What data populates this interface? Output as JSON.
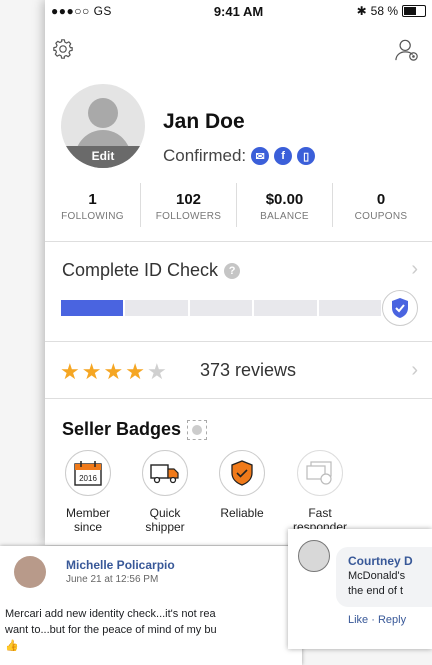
{
  "status_bar": {
    "carrier": "●●●○○ GS",
    "time": "9:41 AM",
    "battery": "58 %",
    "battery_level": 0.58
  },
  "profile": {
    "name": "Jan Doe",
    "confirmed_label": "Confirmed:",
    "edit_label": "Edit",
    "confirmed_icons": [
      "email-icon",
      "facebook-icon",
      "phone-icon"
    ]
  },
  "stats": [
    {
      "value": "1",
      "label": "FOLLOWING"
    },
    {
      "value": "102",
      "label": "FOLLOWERS"
    },
    {
      "value": "$0.00",
      "label": "BALANCE"
    },
    {
      "value": "0",
      "label": "COUPONS"
    }
  ],
  "id_check": {
    "label": "Complete ID Check",
    "progress_segments": 5,
    "progress_filled": 1
  },
  "reviews": {
    "rating": 4,
    "max": 5,
    "label": "373 reviews"
  },
  "seller_badges": {
    "title": "Seller Badges",
    "items": [
      {
        "label": "Member since",
        "icon_text": "2016"
      },
      {
        "label": "Quick shipper",
        "icon": "truck-icon"
      },
      {
        "label": "Reliable",
        "icon": "shield-check-icon"
      },
      {
        "label": "Fast responder",
        "icon": "chat-clock-icon"
      }
    ]
  },
  "post": {
    "author": "Michelle Policarpio",
    "date": "June 21 at 12:56 PM",
    "line1": "Mercari add new identity check...it's not rea",
    "line2": "want to...but for the peace of mind of my bu",
    "emoji": "👍"
  },
  "comment": {
    "author": "Courtney D",
    "line1": "McDonald's",
    "line2": "the end of t",
    "actions": "Like · Reply"
  },
  "colors": {
    "accent": "#4a64e0",
    "star": "#f5a623",
    "badge_orange": "#f07a1a",
    "link": "#385898"
  }
}
